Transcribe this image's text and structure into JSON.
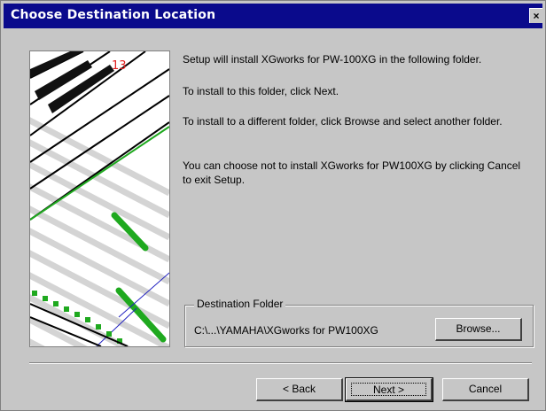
{
  "window": {
    "title": "Choose Destination Location",
    "close_label": "×"
  },
  "messages": {
    "line1": "Setup will install XGworks for PW-100XG in the following folder.",
    "line2": "To install to this folder, click Next.",
    "line3": "To install to a different folder, click Browse and select another folder.",
    "line4": "You can choose not to install XGworks for PW100XG by clicking Cancel to exit Setup."
  },
  "destination": {
    "group_label": "Destination Folder",
    "path": "C:\\...\\YAMAHA\\XGworks for PW100XG",
    "browse_label": "Browse..."
  },
  "buttons": {
    "back": "< Back",
    "next": "Next >",
    "cancel": "Cancel"
  },
  "colors": {
    "title_bar": "#0a0a8c",
    "face": "#c6c6c6",
    "accent_green": "#1fa91f"
  },
  "icons": {
    "close": "close-icon",
    "art": "piano-roll-graphic"
  }
}
